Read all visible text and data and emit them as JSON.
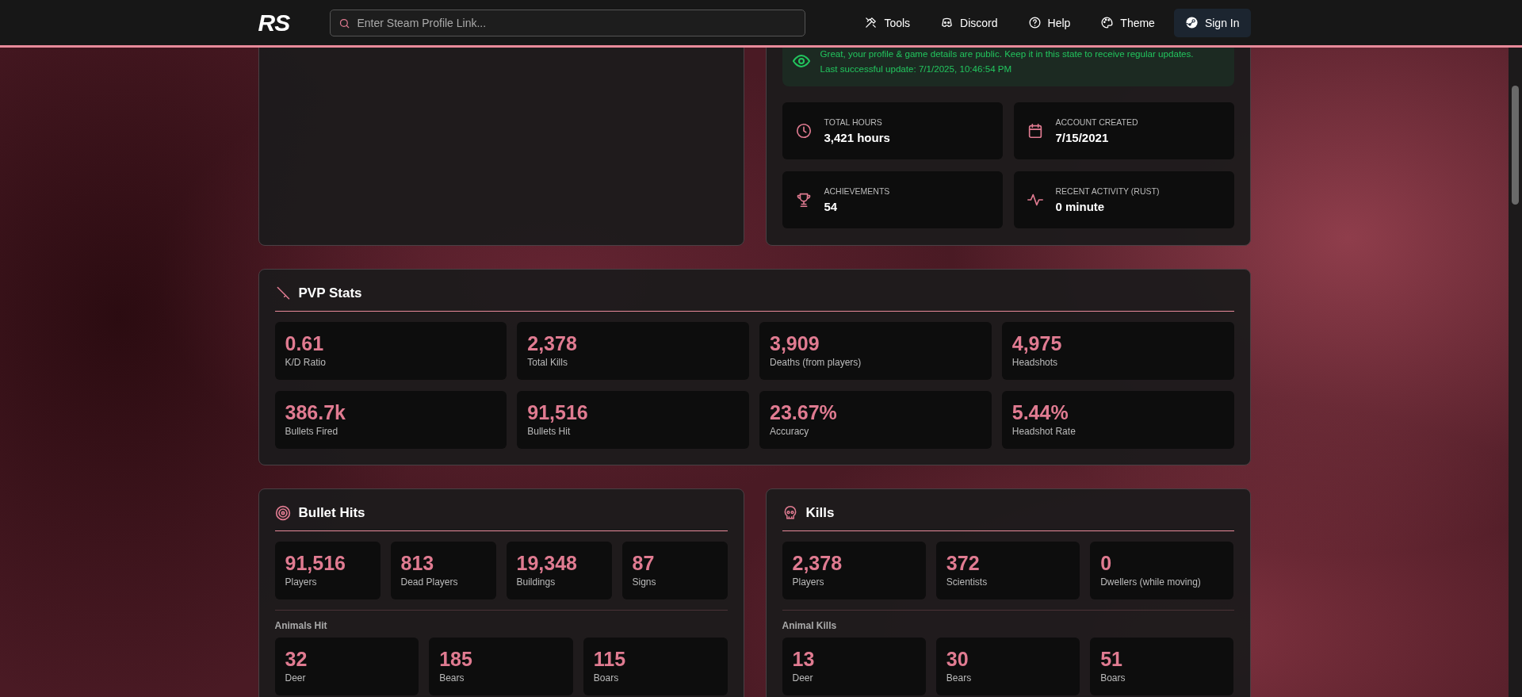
{
  "header": {
    "logo": "RS",
    "search": {
      "placeholder": "Enter Steam Profile Link..."
    },
    "nav": [
      "Tools",
      "Discord",
      "Help",
      "Theme"
    ],
    "sign_in": "Sign In"
  },
  "status": {
    "lines": [
      "Great, your profile & game details are public. Keep it in this state to receive regular updates.",
      "Last successful update: 7/1/2025, 10:46:54 PM"
    ]
  },
  "profile_stats": [
    {
      "label": "TOTAL HOURS",
      "value": "3,421 hours"
    },
    {
      "label": "ACCOUNT CREATED",
      "value": "7/15/2021"
    },
    {
      "label": "ACHIEVEMENTS",
      "value": "54"
    },
    {
      "label": "RECENT ACTIVITY (RUST)",
      "value": "0 minute"
    }
  ],
  "pvp": {
    "title": "PVP Stats",
    "stats": [
      {
        "value": "0.61",
        "label": "K/D Ratio"
      },
      {
        "value": "2,378",
        "label": "Total Kills"
      },
      {
        "value": "3,909",
        "label": "Deaths (from players)"
      },
      {
        "value": "4,975",
        "label": "Headshots"
      },
      {
        "value": "386.7k",
        "label": "Bullets Fired"
      },
      {
        "value": "91,516",
        "label": "Bullets Hit"
      },
      {
        "value": "23.67%",
        "label": "Accuracy"
      },
      {
        "value": "5.44%",
        "label": "Headshot Rate"
      }
    ]
  },
  "bullet_hits": {
    "title": "Bullet Hits",
    "stats": [
      {
        "value": "91,516",
        "label": "Players"
      },
      {
        "value": "813",
        "label": "Dead Players"
      },
      {
        "value": "19,348",
        "label": "Buildings"
      },
      {
        "value": "87",
        "label": "Signs"
      }
    ],
    "animals_title": "Animals Hit",
    "animals": [
      {
        "value": "32",
        "label": "Deer"
      },
      {
        "value": "185",
        "label": "Bears"
      },
      {
        "value": "115",
        "label": "Boars"
      }
    ]
  },
  "kills": {
    "title": "Kills",
    "stats": [
      {
        "value": "2,378",
        "label": "Players"
      },
      {
        "value": "372",
        "label": "Scientists"
      },
      {
        "value": "0",
        "label": "Dwellers (while moving)"
      }
    ],
    "animals_title": "Animal Kills",
    "animals": [
      {
        "value": "13",
        "label": "Deer"
      },
      {
        "value": "30",
        "label": "Bears"
      },
      {
        "value": "51",
        "label": "Boars"
      }
    ]
  }
}
